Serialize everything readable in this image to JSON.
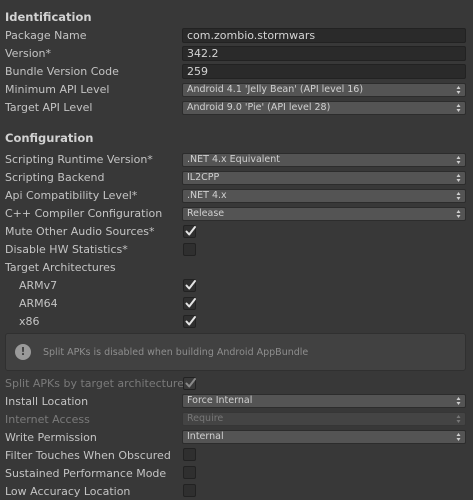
{
  "identification": {
    "header": "Identification",
    "package_name": {
      "label": "Package Name",
      "value": "com.zombio.stormwars"
    },
    "version": {
      "label": "Version*",
      "value": "342.2"
    },
    "bundle_version_code": {
      "label": "Bundle Version Code",
      "value": "259"
    },
    "min_api_level": {
      "label": "Minimum API Level",
      "value": "Android 4.1 'Jelly Bean' (API level 16)"
    },
    "target_api_level": {
      "label": "Target API Level",
      "value": "Android 9.0 'Pie' (API level 28)"
    }
  },
  "configuration": {
    "header": "Configuration",
    "scripting_runtime": {
      "label": "Scripting Runtime Version*",
      "value": ".NET 4.x Equivalent"
    },
    "scripting_backend": {
      "label": "Scripting Backend",
      "value": "IL2CPP"
    },
    "api_compat": {
      "label": "Api Compatibility Level*",
      "value": ".NET 4.x"
    },
    "cpp_compiler": {
      "label": "C++ Compiler Configuration",
      "value": "Release"
    },
    "mute_other_audio": {
      "label": "Mute Other Audio Sources*",
      "checked": true
    },
    "disable_hw_stats": {
      "label": "Disable HW Statistics*",
      "checked": false
    },
    "target_architectures": {
      "label": "Target Architectures",
      "items": [
        {
          "label": "ARMv7",
          "checked": true
        },
        {
          "label": "ARM64",
          "checked": true
        },
        {
          "label": "x86",
          "checked": true
        }
      ]
    },
    "info_message": "Split APKs is disabled when building Android AppBundle",
    "split_apks": {
      "label": "Split APKs by target architecture",
      "checked": true,
      "disabled": true
    },
    "install_location": {
      "label": "Install Location",
      "value": "Force Internal"
    },
    "internet_access": {
      "label": "Internet Access",
      "value": "Require",
      "disabled": true
    },
    "write_permission": {
      "label": "Write Permission",
      "value": "Internal"
    },
    "filter_touches": {
      "label": "Filter Touches When Obscured",
      "checked": false
    },
    "sustained_performance": {
      "label": "Sustained Performance Mode",
      "checked": false
    },
    "low_accuracy_location": {
      "label": "Low Accuracy Location",
      "checked": false
    }
  },
  "icons": {
    "info": "info-icon",
    "dropdown": "dropdown-arrows-icon",
    "check": "checkmark-icon"
  }
}
